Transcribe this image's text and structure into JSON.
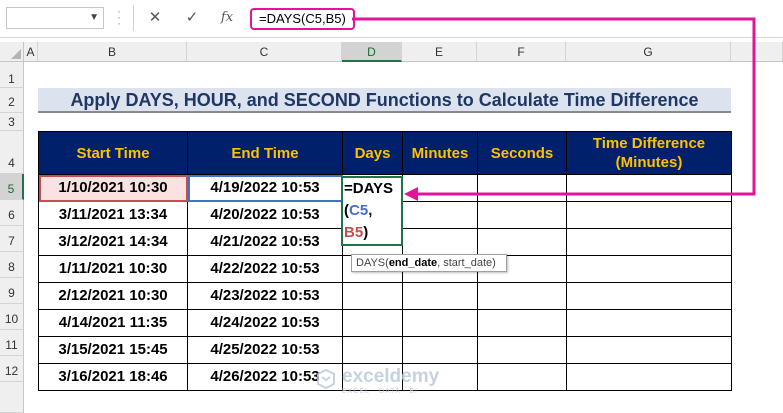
{
  "formula_bar": {
    "name_box": "",
    "cancel_icon": "✕",
    "enter_icon": "✓",
    "fx_label": "fx",
    "formula": "=DAYS(C5,B5)"
  },
  "columns": [
    "A",
    "B",
    "C",
    "D",
    "E",
    "F",
    "G"
  ],
  "rows": [
    "1",
    "2",
    "3",
    "4",
    "5",
    "6",
    "7",
    "8",
    "9",
    "10",
    "11",
    "12"
  ],
  "title": "Apply DAYS, HOUR, and SECOND Functions to Calculate Time Difference",
  "table": {
    "headers": [
      "Start Time",
      "End Time",
      "Days",
      "Minutes",
      "Seconds",
      "Time Difference (Minutes)"
    ],
    "header_g_line1": "Time Difference",
    "header_g_line2": "(Minutes)",
    "rows": [
      {
        "start": "1/10/2021 10:30",
        "end": "4/19/2022 10:53"
      },
      {
        "start": "3/11/2021 13:34",
        "end": "4/20/2022 10:53"
      },
      {
        "start": "3/12/2021 14:34",
        "end": "4/21/2022 10:53"
      },
      {
        "start": "1/11/2021 10:30",
        "end": "4/22/2022 10:53"
      },
      {
        "start": "2/12/2021 10:30",
        "end": "4/23/2022 10:53"
      },
      {
        "start": "4/14/2021 11:35",
        "end": "4/24/2022 10:53"
      },
      {
        "start": "3/15/2021 15:45",
        "end": "4/25/2022 10:53"
      },
      {
        "start": "3/16/2021 18:46",
        "end": "4/26/2022 10:53"
      }
    ]
  },
  "edit_cell": {
    "part1": "=DAYS",
    "part2": "(",
    "ref1": "C5",
    "comma": ",",
    "ref2": "B5",
    "close": ")"
  },
  "tooltip": {
    "fn": "DAYS(",
    "arg1": "end_date",
    "rest": ", start_date)"
  },
  "watermark": {
    "name": "exceldemy",
    "sub": "EXCEL · DATA · BI"
  },
  "colors": {
    "header_bg": "#00206b",
    "header_text": "#ffc000",
    "title_text": "#1f3763",
    "arrow": "#e1149b"
  }
}
